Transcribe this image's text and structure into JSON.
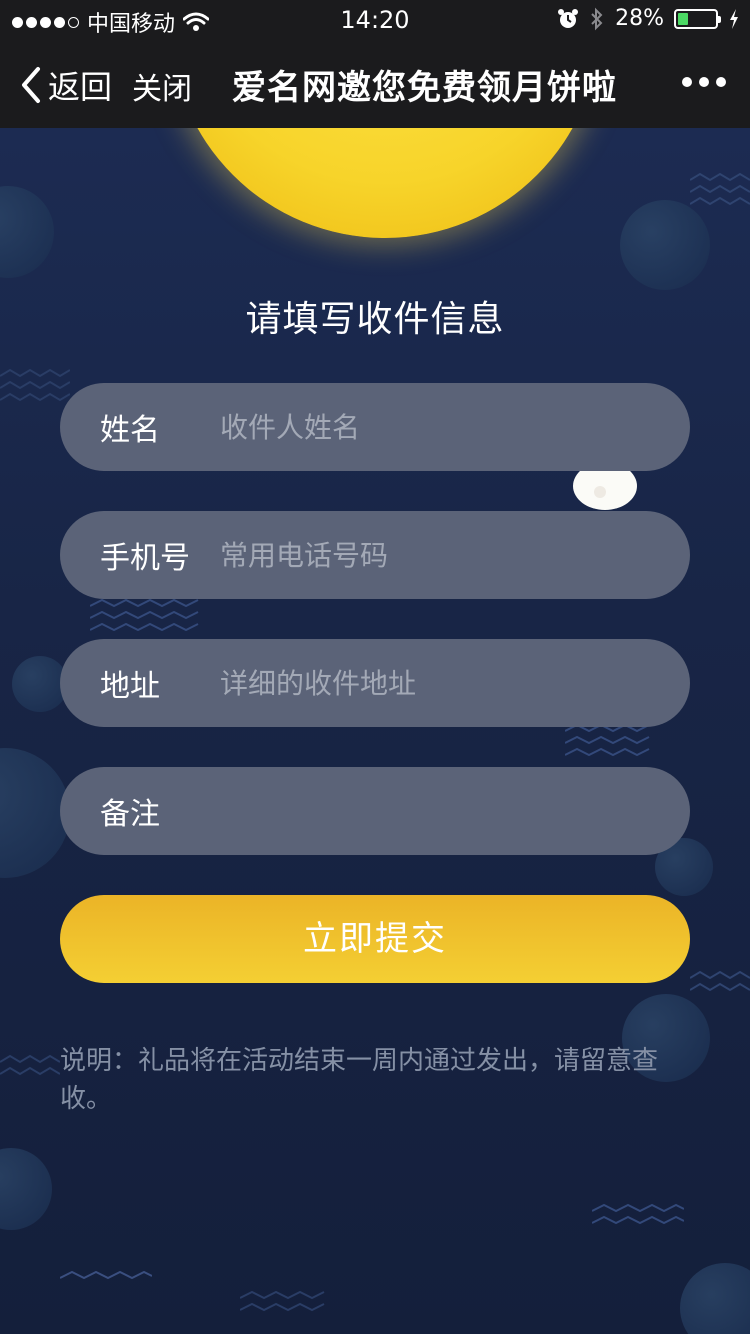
{
  "status_bar": {
    "carrier": "中国移动",
    "time": "14:20",
    "battery_percent": "28%",
    "battery_level": 0.28,
    "signal_bars_filled": 4,
    "signal_bars_total": 5
  },
  "nav": {
    "back_label": "返回",
    "close_label": "关闭",
    "title": "爱名网邀您免费领月饼啦"
  },
  "form": {
    "title": "请填写收件信息",
    "fields": [
      {
        "label": "姓名",
        "placeholder": "收件人姓名",
        "value": ""
      },
      {
        "label": "手机号",
        "placeholder": "常用电话号码",
        "value": ""
      },
      {
        "label": "地址",
        "placeholder": "详细的收件地址",
        "value": ""
      },
      {
        "label": "备注",
        "placeholder": "",
        "value": ""
      }
    ],
    "submit_label": "立即提交",
    "note": "说明：礼品将在活动结束一周内通过发出，请留意查收。"
  },
  "colors": {
    "accent": "#f4cf33",
    "field_bg": "#5b6378",
    "page_bg": "#16223f",
    "battery_fill": "#4cd964"
  }
}
